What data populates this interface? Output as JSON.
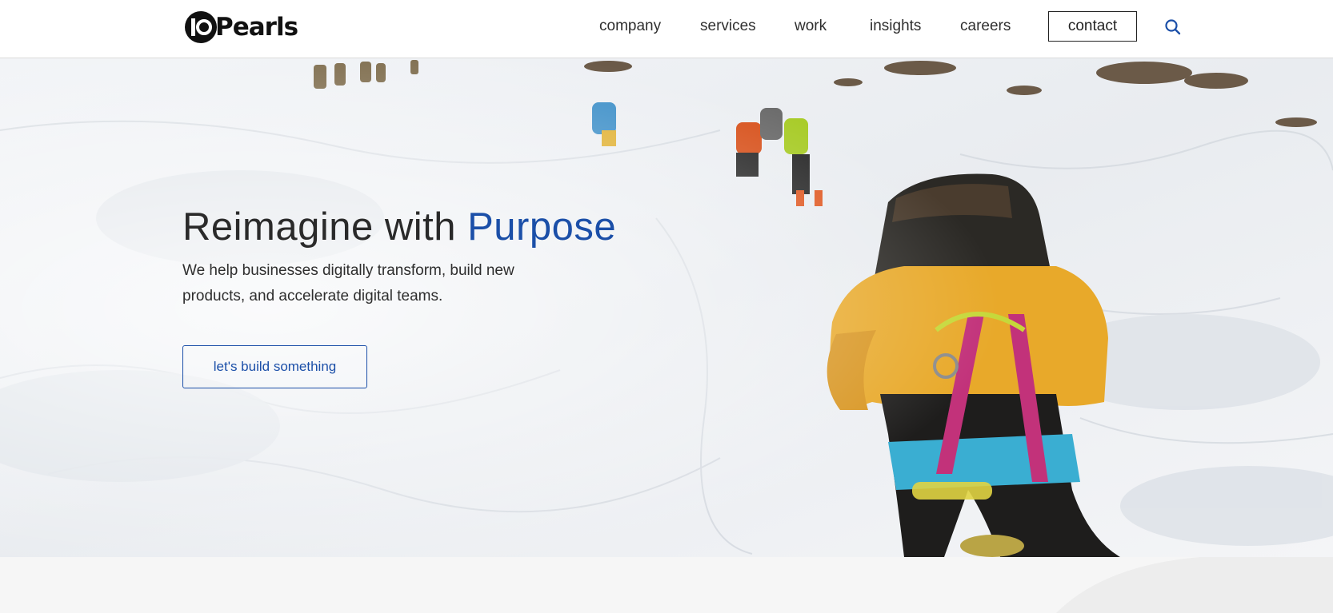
{
  "header": {
    "logo_text": "10Pearls",
    "nav": [
      "company",
      "services",
      "work",
      "insights",
      "careers"
    ],
    "contact_label": "contact",
    "search_icon": "search-icon"
  },
  "hero": {
    "title_main": "Reimagine with",
    "title_accent": "Purpose",
    "subtitle": "We help businesses digitally transform, build new products, and accelerate digital teams.",
    "cta_label": "let's build something"
  },
  "colors": {
    "accent": "#1b4fa8",
    "text": "#2b2b2b",
    "jacket": "#e8a92a",
    "strap": "#c2327a",
    "harness": "#3aaed2"
  }
}
